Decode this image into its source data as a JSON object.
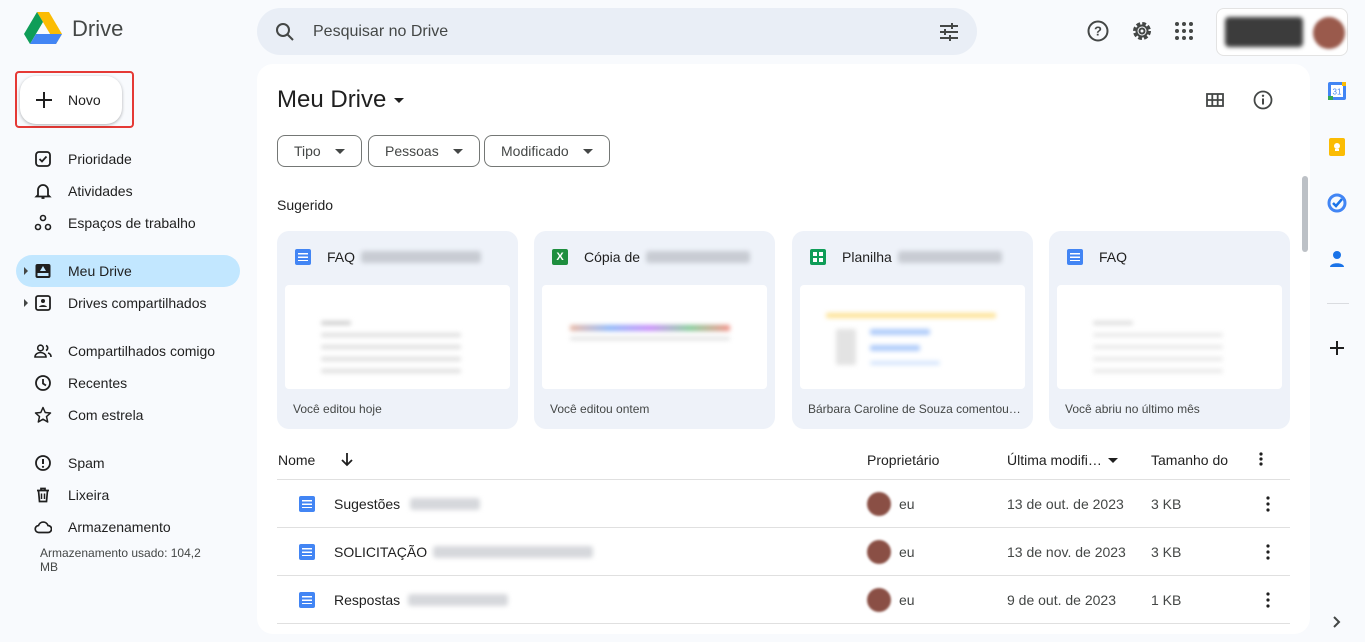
{
  "app": {
    "name": "Drive"
  },
  "search": {
    "placeholder": "Pesquisar no Drive"
  },
  "sidebar": {
    "new_label": "Novo",
    "items": [
      {
        "label": "Prioridade"
      },
      {
        "label": "Atividades"
      },
      {
        "label": "Espaços de trabalho"
      },
      {
        "label": "Meu Drive"
      },
      {
        "label": "Drives compartilhados"
      },
      {
        "label": "Compartilhados comigo"
      },
      {
        "label": "Recentes"
      },
      {
        "label": "Com estrela"
      },
      {
        "label": "Spam"
      },
      {
        "label": "Lixeira"
      },
      {
        "label": "Armazenamento"
      }
    ],
    "storage_text": "Armazenamento usado: 104,2 MB"
  },
  "main": {
    "title": "Meu Drive",
    "filters": [
      "Tipo",
      "Pessoas",
      "Modificado"
    ],
    "suggested_label": "Sugerido",
    "suggested": [
      {
        "name": "FAQ",
        "footer": "Você editou hoje",
        "icon": "docs-icon"
      },
      {
        "name": "Cópia de",
        "footer": "Você editou ontem",
        "icon": "excel-icon"
      },
      {
        "name": "Planilha",
        "footer": "Bárbara Caroline de Souza comentou…",
        "icon": "sheets-icon"
      },
      {
        "name": "FAQ",
        "footer": "Você abriu no último mês",
        "icon": "docs-icon"
      }
    ],
    "table": {
      "headers": {
        "name": "Nome",
        "owner": "Proprietário",
        "modified": "Última modifi…",
        "size": "Tamanho do"
      },
      "rows": [
        {
          "name": "Sugestões",
          "owner": "eu",
          "date": "13 de out. de 2023",
          "size": "3 KB"
        },
        {
          "name": "SOLICITAÇÃO",
          "owner": "eu",
          "date": "13 de nov. de 2023",
          "size": "3 KB"
        },
        {
          "name": "Respostas",
          "owner": "eu",
          "date": "9 de out. de 2023",
          "size": "1 KB"
        }
      ]
    }
  },
  "colors": {
    "accent": "#c2e7ff",
    "highlight_border": "#e53935",
    "doc_blue": "#4285f4",
    "sheets_green": "#0f9d58"
  }
}
